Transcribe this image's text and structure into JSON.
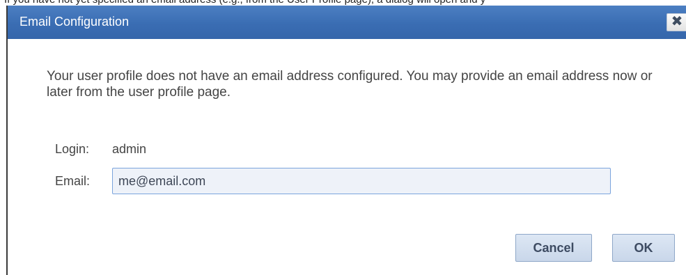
{
  "background": {
    "text": "If you have not yet specified an email address (e.g., from the User Profile page), a dialog will open and y"
  },
  "dialog": {
    "title": "Email Configuration",
    "close_icon": "close-icon",
    "message": "Your user profile does not have an email address configured. You may provide an email address now or later from the user profile page.",
    "login": {
      "label": "Login:",
      "value": "admin"
    },
    "email": {
      "label": "Email:",
      "value": "me@email.com"
    },
    "buttons": {
      "cancel": "Cancel",
      "ok": "OK"
    }
  },
  "colors": {
    "titlebar": "#3a6db3",
    "button": "#c9d7ea",
    "input_border": "#7aa4dd"
  }
}
